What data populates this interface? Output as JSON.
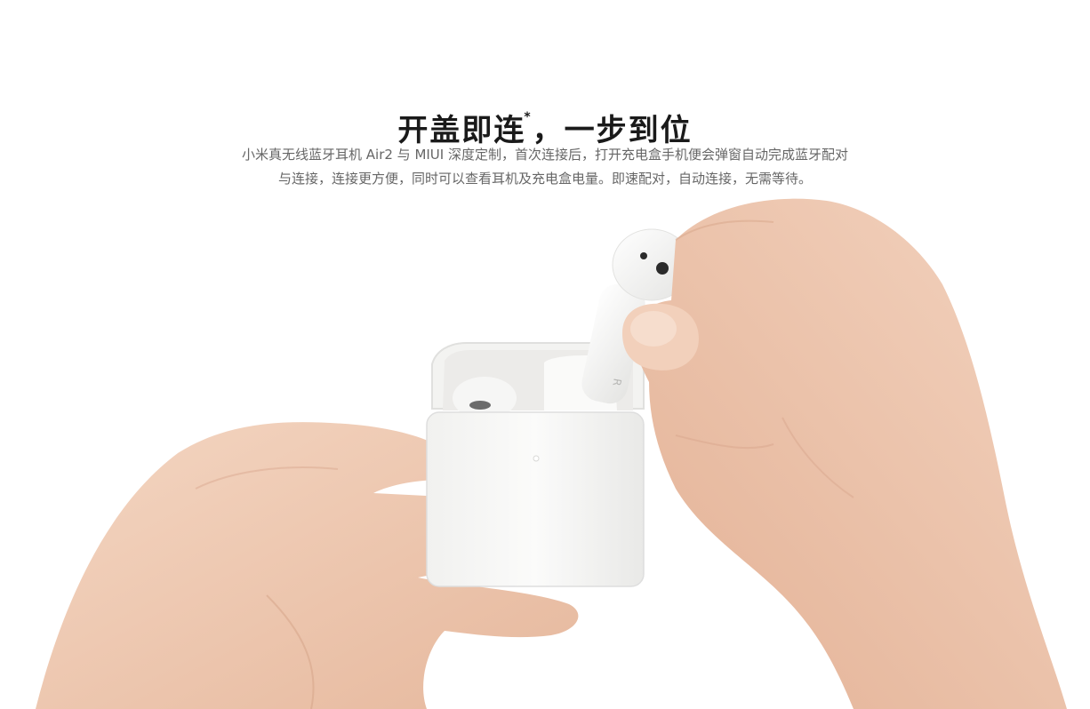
{
  "section": {
    "title": "开盖即连",
    "title_mark": "*",
    "title_rest": "，一步到位",
    "description_line1": "小米真无线蓝牙耳机 Air2 与 MIUI 深度定制，首次连接后，打开充电盒手机便会弹窗自动完成蓝牙配对",
    "description_line2": "与连接，连接更方便，同时可以查看耳机及充电盒电量。即速配对，自动连接，无需等待。"
  },
  "product_image": {
    "earbud_mark": "R"
  },
  "colors": {
    "skin": "#f1cdb5",
    "skin_shadow": "#d9a98d",
    "case": "#f7f7f5",
    "case_shadow": "#dcdcda",
    "title": "#1a1a1a",
    "body_text": "#666666"
  }
}
